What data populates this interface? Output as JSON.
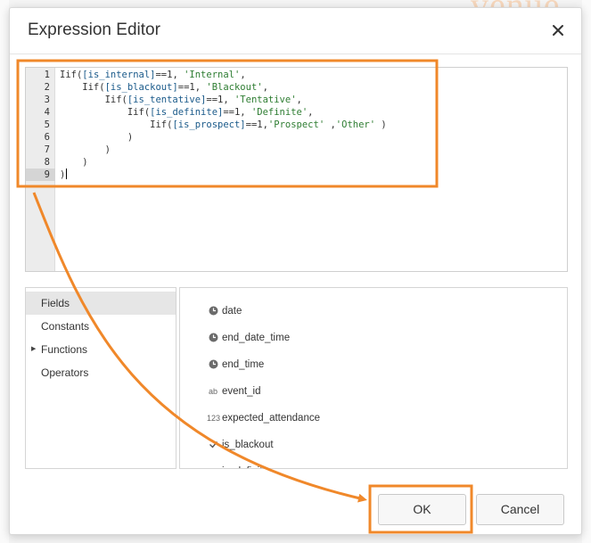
{
  "background": {
    "watermark": "venue"
  },
  "dialog": {
    "title": "Expression Editor",
    "close_icon": "close-icon"
  },
  "editor": {
    "active_line": 9,
    "line_numbers": [
      "1",
      "2",
      "3",
      "4",
      "5",
      "6",
      "7",
      "8",
      "9"
    ],
    "lines": [
      [
        {
          "t": "t",
          "v": "Iif("
        },
        {
          "t": "i",
          "v": "[is_internal]"
        },
        {
          "t": "t",
          "v": "==1, "
        },
        {
          "t": "s",
          "v": "'Internal'"
        },
        {
          "t": "t",
          "v": ","
        }
      ],
      [
        {
          "t": "t",
          "v": "    Iif("
        },
        {
          "t": "i",
          "v": "[is_blackout]"
        },
        {
          "t": "t",
          "v": "==1, "
        },
        {
          "t": "s",
          "v": "'Blackout'"
        },
        {
          "t": "t",
          "v": ","
        }
      ],
      [
        {
          "t": "t",
          "v": "        Iif("
        },
        {
          "t": "i",
          "v": "[is_tentative]"
        },
        {
          "t": "t",
          "v": "==1, "
        },
        {
          "t": "s",
          "v": "'Tentative'"
        },
        {
          "t": "t",
          "v": ","
        }
      ],
      [
        {
          "t": "t",
          "v": "            Iif("
        },
        {
          "t": "i",
          "v": "[is_definite]"
        },
        {
          "t": "t",
          "v": "==1, "
        },
        {
          "t": "s",
          "v": "'Definite'"
        },
        {
          "t": "t",
          "v": ","
        }
      ],
      [
        {
          "t": "t",
          "v": "                Iif("
        },
        {
          "t": "i",
          "v": "[is_prospect]"
        },
        {
          "t": "t",
          "v": "==1,"
        },
        {
          "t": "s",
          "v": "'Prospect'"
        },
        {
          "t": "t",
          "v": " ,"
        },
        {
          "t": "s",
          "v": "'Other'"
        },
        {
          "t": "t",
          "v": " )"
        }
      ],
      [
        {
          "t": "t",
          "v": "            )"
        }
      ],
      [
        {
          "t": "t",
          "v": "        )"
        }
      ],
      [
        {
          "t": "t",
          "v": "    )"
        }
      ],
      [
        {
          "t": "t",
          "v": ")"
        }
      ]
    ]
  },
  "categories": [
    {
      "label": "Fields",
      "selected": true,
      "expandable": false
    },
    {
      "label": "Constants",
      "selected": false,
      "expandable": false
    },
    {
      "label": "Functions",
      "selected": false,
      "expandable": true
    },
    {
      "label": "Operators",
      "selected": false,
      "expandable": false
    }
  ],
  "fields": [
    {
      "label": "date",
      "icon": "clock-icon"
    },
    {
      "label": "end_date_time",
      "icon": "clock-icon"
    },
    {
      "label": "end_time",
      "icon": "clock-icon"
    },
    {
      "label": "event_id",
      "icon": "text-type-icon",
      "icon_text": "ab"
    },
    {
      "label": "expected_attendance",
      "icon": "number-type-icon",
      "icon_text": "123"
    },
    {
      "label": "is_blackout",
      "icon": "checkmark-icon"
    },
    {
      "label": "is_definite",
      "icon": "checkmark-icon"
    }
  ],
  "buttons": {
    "ok": "OK",
    "cancel": "Cancel"
  },
  "annotation": {
    "color": "#f0882a"
  }
}
